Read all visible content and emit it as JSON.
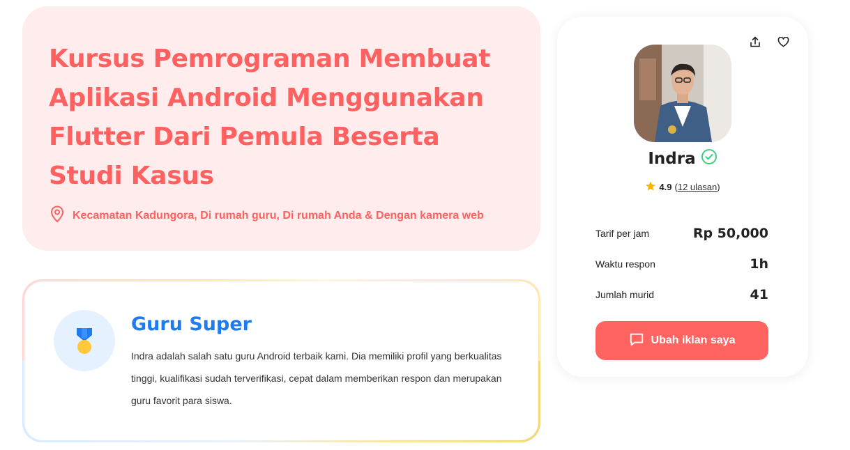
{
  "hero": {
    "title": "Kursus Pemrograman Membuat Aplikasi Android Menggunakan Flutter Dari Pemula Beserta Studi Kasus",
    "location": "Kecamatan Kadungora, Di rumah guru, Di rumah Anda & Dengan kamera web",
    "location_icon": "map-pin-icon"
  },
  "super_tutor": {
    "title": "Guru Super",
    "description": "Indra adalah salah satu guru Android terbaik kami. Dia memiliki profil yang berkualitas tinggi, kualifikasi sudah terverifikasi, cepat dalam memberikan respon dan merupakan guru favorit para siswa.",
    "icon": "medal-icon"
  },
  "profile": {
    "name": "Indra",
    "verified_icon": "verified-check-icon",
    "rating": "4.9",
    "reviews_label": "12 ulasan",
    "stats": [
      {
        "label": "Tarif per jam",
        "value": "Rp 50,000"
      },
      {
        "label": "Waktu respon",
        "value": "1h"
      },
      {
        "label": "Jumlah murid",
        "value": "41"
      }
    ],
    "cta_label": "Ubah iklan saya"
  },
  "colors": {
    "accent": "#ff6161",
    "hero_bg": "#ffecec",
    "super_title": "#1e7bf0",
    "cta_bg": "#ff6461",
    "verified": "#3ccf7a",
    "star": "#f6b500"
  }
}
